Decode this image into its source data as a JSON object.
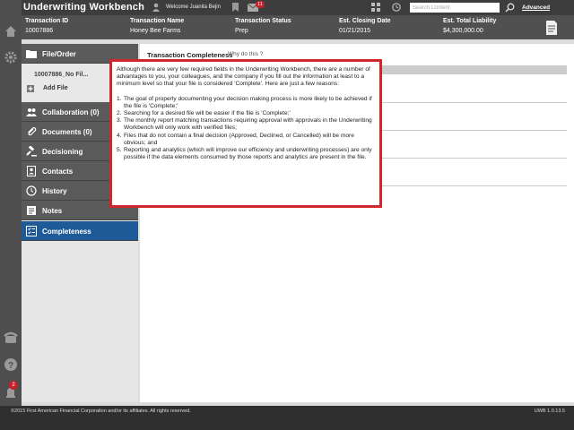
{
  "header": {
    "app_title": "Underwriting Workbench",
    "welcome_text": "Welcome Juanita Bejin",
    "mail_count": "11",
    "search_placeholder": "Search Content",
    "advanced_link": "Advanced"
  },
  "transaction": {
    "columns": [
      {
        "label": "Transaction ID",
        "value": "10007886"
      },
      {
        "label": "Transaction Name",
        "value": "Honey Bee Farms"
      },
      {
        "label": "Transaction Status",
        "value": "Prep"
      },
      {
        "label": "Est. Closing Date",
        "value": "01/21/2015"
      },
      {
        "label": "Est. Total Liability",
        "value": "$4,300,000.00"
      }
    ]
  },
  "nav": {
    "file_order": "File/Order",
    "file_name": "10007886_No Fil...",
    "add_file": "Add File",
    "collaboration": "Collaboration (0)",
    "documents": "Documents (0)",
    "decisioning": "Decisioning",
    "contacts": "Contacts",
    "history": "History",
    "notes": "Notes",
    "completeness": "Completeness"
  },
  "rail": {
    "notification_count": "2"
  },
  "main": {
    "tab_title": "Transaction Completeness",
    "why_link": "Why do this ?"
  },
  "popup": {
    "intro": "Although there are very few required fields in the Underwriting Workbench, there are a number of advantages to you, your colleagues, and the company if you fill out the information at least to a minimum level so that your file is considered 'Complete'. Here are just a few reasons:",
    "reasons": [
      {
        "num": "1.",
        "text": "The goal of properly documenting your decision making process is more likely to be achieved if the file is 'Complete;'"
      },
      {
        "num": "2.",
        "text": "Searching for a desired file will be easier if the file is 'Complete;'"
      },
      {
        "num": "3.",
        "text": "The monthly report matching transactions requiring approval with approvals in the Underwriting Workbench will only work with verified files;"
      },
      {
        "num": "4.",
        "text": "Files that do not contain a final decision (Approved, Declined, or Cancelled) will be more obvious; and"
      },
      {
        "num": "5.",
        "text": "Reporting and analytics (which will improve our efficiency and underwriting processes) are only possible if the data elements consumed by those reports and analytics are present in the file."
      }
    ]
  },
  "footer": {
    "copyright": "©2015 First American Financial Corporation and/or its affiliates. All rights reserved.",
    "version": "UWB 1.0.13.5"
  },
  "colors": {
    "header_bg": "#3d3d3d",
    "active_nav": "#1f5a98",
    "popup_border": "#d1262b",
    "badge": "#c8202a"
  }
}
